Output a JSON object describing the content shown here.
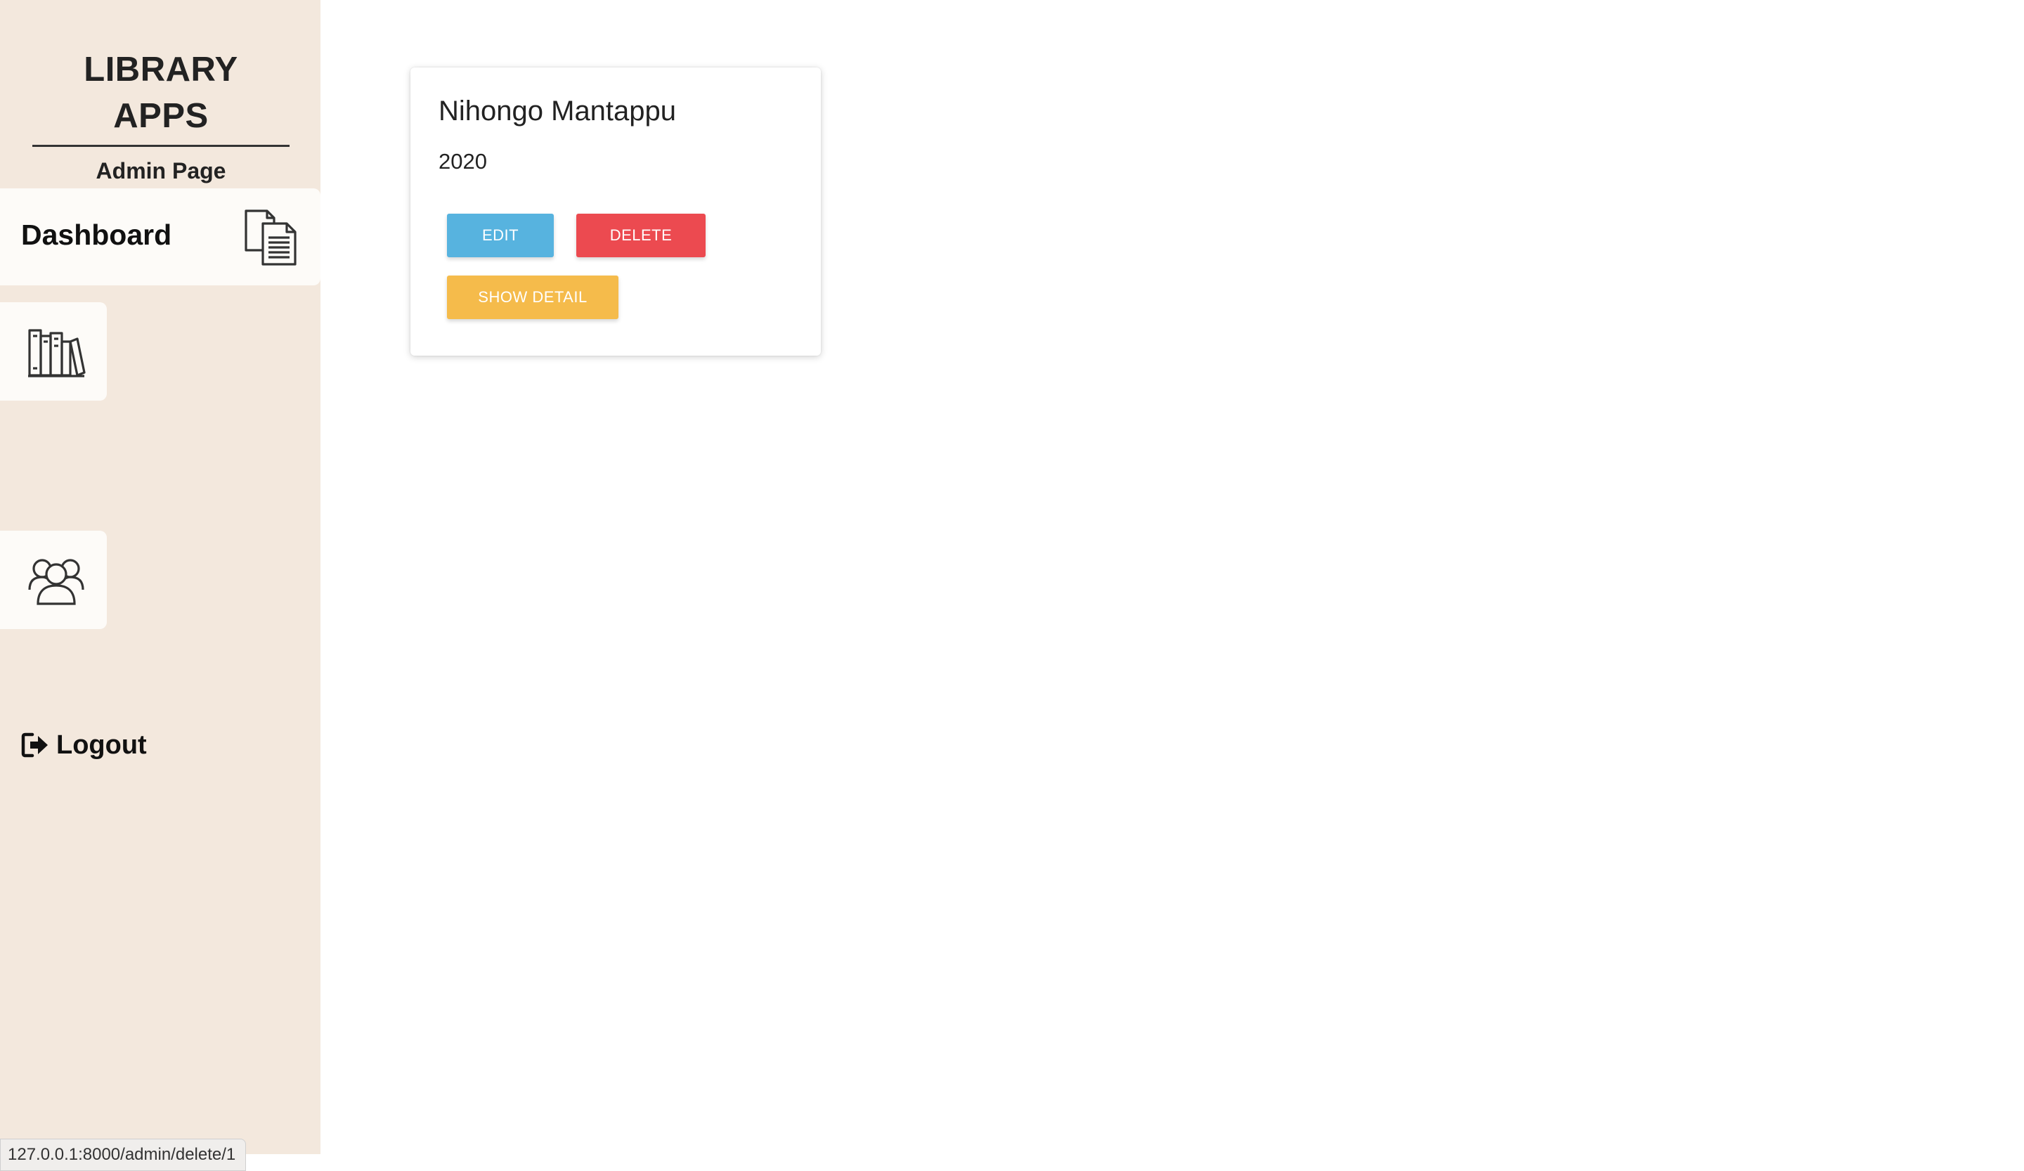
{
  "sidebar": {
    "brand_title": "LIBRARY APPS",
    "brand_subtitle": "Admin Page",
    "nav": {
      "dashboard_label": "Dashboard",
      "dashboard_icon": "documents-icon",
      "books_icon": "books-icon",
      "users_icon": "users-group-icon"
    },
    "logout_label": "Logout",
    "logout_icon": "logout-icon",
    "background_color": "#f3e8dd"
  },
  "book_card": {
    "title": "Nihongo Mantappu",
    "year": "2020",
    "buttons": {
      "edit": "EDIT",
      "delete": "DELETE",
      "show_detail": "SHOW DETAIL"
    },
    "colors": {
      "edit": "#57b3df",
      "delete": "#ec4a50",
      "show_detail": "#f5bb4b"
    }
  },
  "status_bar": {
    "url": "127.0.0.1:8000/admin/delete/1"
  }
}
